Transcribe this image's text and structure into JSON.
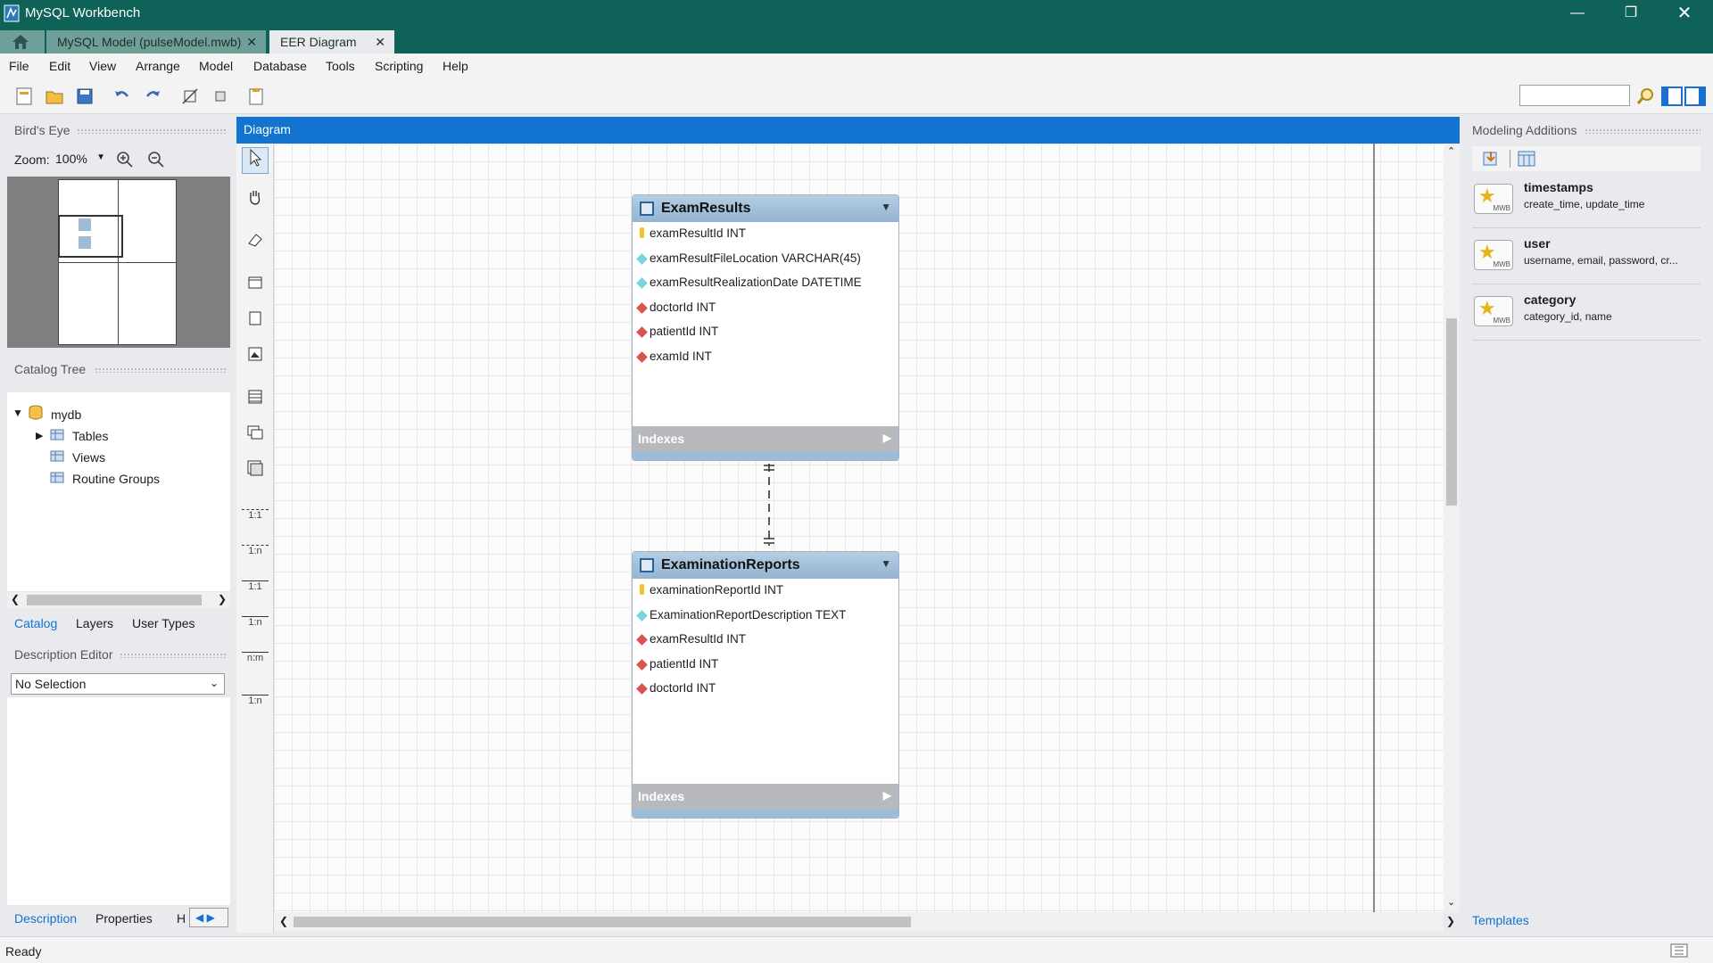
{
  "window": {
    "title": "MySQL Workbench"
  },
  "tabs": [
    {
      "label": "MySQL Model (pulseModel.mwb)"
    },
    {
      "label": "EER Diagram"
    }
  ],
  "menu": [
    "File",
    "Edit",
    "View",
    "Arrange",
    "Model",
    "Database",
    "Tools",
    "Scripting",
    "Help"
  ],
  "left": {
    "birds_eye_title": "Bird's Eye",
    "zoom_label": "Zoom:",
    "zoom_value": "100%",
    "catalog_title": "Catalog Tree",
    "tree": {
      "root": "mydb",
      "items": [
        "Tables",
        "Views",
        "Routine Groups"
      ]
    },
    "catalog_tabs": [
      "Catalog",
      "Layers",
      "User Types"
    ],
    "desc_title": "Description Editor",
    "desc_select": "No Selection",
    "bottom_tabs": [
      "Description",
      "Properties",
      "H"
    ]
  },
  "diagram": {
    "title": "Diagram",
    "relation_tools": [
      "1:1",
      "1:n",
      "1:1",
      "1:n",
      "n:m",
      "1:n"
    ],
    "entities": [
      {
        "name": "ExamResults",
        "columns": [
          {
            "text": "examResultId INT",
            "key": "pk"
          },
          {
            "text": "examResultFileLocation VARCHAR(45)",
            "key": "nn"
          },
          {
            "text": "examResultRealizationDate DATETIME",
            "key": "nn"
          },
          {
            "text": "doctorId INT",
            "key": "fk"
          },
          {
            "text": "patientId INT",
            "key": "fk"
          },
          {
            "text": "examId INT",
            "key": "fk"
          }
        ],
        "indexes_label": "Indexes"
      },
      {
        "name": "ExaminationReports",
        "columns": [
          {
            "text": "examinationReportId INT",
            "key": "pk"
          },
          {
            "text": "ExaminationReportDescription TEXT",
            "key": "nn"
          },
          {
            "text": "examResultId INT",
            "key": "fk"
          },
          {
            "text": "patientId INT",
            "key": "fk"
          },
          {
            "text": "doctorId INT",
            "key": "fk"
          }
        ],
        "indexes_label": "Indexes"
      }
    ]
  },
  "right": {
    "title": "Modeling Additions",
    "templates": [
      {
        "name": "timestamps",
        "desc": "create_time, update_time"
      },
      {
        "name": "user",
        "desc": "username, email, password, cr..."
      },
      {
        "name": "category",
        "desc": "category_id, name"
      }
    ],
    "tab": "Templates"
  },
  "status": {
    "text": "Ready"
  },
  "colors": {
    "titlebar": "#0f6258",
    "diagram_header": "#1373d1",
    "entity_header": "#9ebcd5",
    "pk": "#f1c232",
    "fk": "#d9534f",
    "nn": "#7ad3e0"
  }
}
